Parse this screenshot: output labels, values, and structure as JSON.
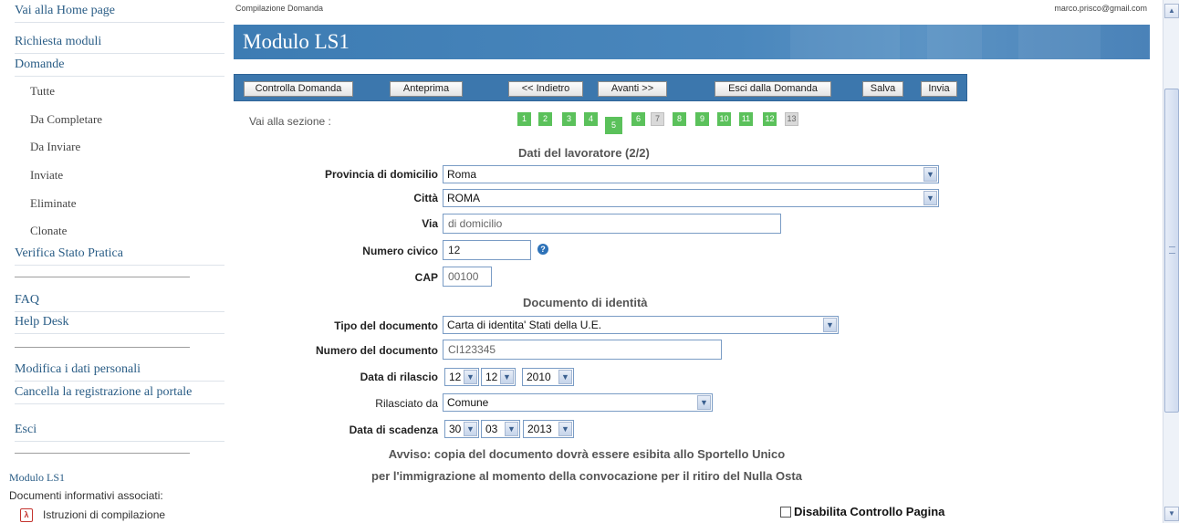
{
  "sidebar": {
    "links": {
      "home": "Vai alla Home page",
      "richiesta_moduli": "Richiesta moduli",
      "domande": "Domande",
      "tutte": "Tutte",
      "da_completare": "Da Completare",
      "da_inviare": "Da Inviare",
      "inviate": "Inviate",
      "eliminate": "Eliminate",
      "clonate": "Clonate",
      "verifica_stato": "Verifica Stato Pratica",
      "faq": "FAQ",
      "help_desk": "Help Desk",
      "modifica_dati": "Modifica i dati personali",
      "cancella_registrazione": "Cancella la registrazione al portale",
      "esci": "Esci"
    },
    "module_title": "Modulo LS1",
    "docs_label": "Documenti informativi associati:",
    "doc_item": "Istruzioni di compilazione"
  },
  "header": {
    "breadcrumb": "Compilazione Domanda",
    "user_email": "marco.prisco@gmail.com",
    "title": "Modulo LS1"
  },
  "toolbar": {
    "controlla": "Controlla Domanda",
    "anteprima": "Anteprima",
    "indietro": "<< Indietro",
    "avanti": "Avanti >>",
    "esci": "Esci dalla Domanda",
    "salva": "Salva",
    "invia": "Invia"
  },
  "pager": {
    "label": "Vai alla sezione :",
    "pages": [
      "1",
      "2",
      "3",
      "4",
      "5",
      "6",
      "7",
      "8",
      "9",
      "10",
      "11",
      "12",
      "13"
    ],
    "current": "5"
  },
  "form": {
    "section1_title": "Dati del lavoratore (2/2)",
    "provincia": {
      "label": "Provincia di domicilio",
      "value": "Roma"
    },
    "citta": {
      "label": "Città",
      "value": "ROMA"
    },
    "via": {
      "label": "Via",
      "value": "di domicilio"
    },
    "numero_civico": {
      "label": "Numero civico",
      "value": "12"
    },
    "cap": {
      "label": "CAP",
      "value": "00100"
    },
    "section2_title": "Documento di identità",
    "tipo_documento": {
      "label": "Tipo del documento",
      "value": "Carta di identita' Stati della U.E."
    },
    "numero_documento": {
      "label": "Numero del documento",
      "value": "CI123345"
    },
    "data_rilascio": {
      "label": "Data di rilascio",
      "day": "12",
      "month": "12",
      "year": "2010"
    },
    "rilasciato_da": {
      "label": "Rilasciato da",
      "value": "Comune"
    },
    "data_scadenza": {
      "label": "Data di scadenza",
      "day": "30",
      "month": "03",
      "year": "2013"
    },
    "notice_line1": "Avviso: copia del documento dovrà essere esibita allo Sportello Unico",
    "notice_line2": "per l'immigrazione al momento della convocazione per il ritiro del Nulla Osta",
    "disable_check_label": "Disabilita Controllo Pagina"
  },
  "icons": {
    "help": "help-icon",
    "pdf": "pdf-icon",
    "dropdown": "chevron-down-icon"
  },
  "colors": {
    "banner": "#3d7cb3",
    "toolbar": "#3c77ad",
    "pager_green": "#5bc15b",
    "link": "#2a5d86"
  }
}
